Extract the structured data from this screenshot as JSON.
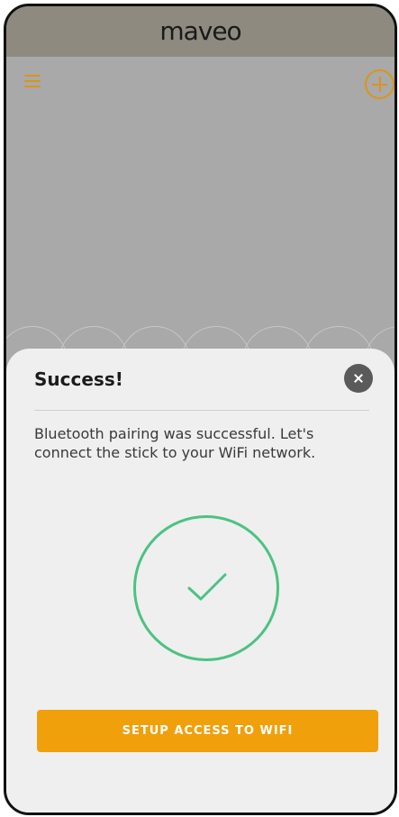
{
  "app": {
    "logo_text": "maveo"
  },
  "header": {
    "menu_icon": "hamburger-menu-icon",
    "add_icon": "plus-circle-icon"
  },
  "dialog": {
    "title": "Success!",
    "message": "Bluetooth pairing was successful. Let's connect the stick to your WiFi network.",
    "close_icon": "close-icon",
    "status_icon": "check-circle-icon",
    "cta_label": "SETUP ACCESS TO WIFI"
  },
  "colors": {
    "accent": "#f0a00b",
    "success": "#4cc283",
    "overlay": "#a9a9a9"
  }
}
